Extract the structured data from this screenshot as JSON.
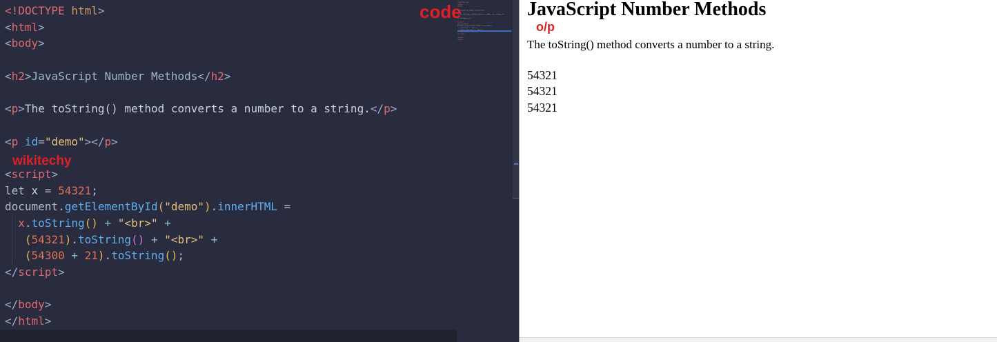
{
  "editor": {
    "watermark_top": "code",
    "watermark_overlay": "wikitechy",
    "lines": [
      {
        "tokens": [
          [
            "<!DOCTYPE",
            "red"
          ],
          [
            " html",
            "orange"
          ],
          [
            ">",
            "br"
          ]
        ]
      },
      {
        "tokens": [
          [
            "<",
            "br"
          ],
          [
            "html",
            "red"
          ],
          [
            ">",
            "br"
          ]
        ]
      },
      {
        "tokens": [
          [
            "<",
            "br"
          ],
          [
            "body",
            "red"
          ],
          [
            ">",
            "br"
          ]
        ]
      },
      {
        "tokens": []
      },
      {
        "tokens": [
          [
            "<",
            "br"
          ],
          [
            "h2",
            "red"
          ],
          [
            ">",
            "br"
          ],
          [
            "JavaScript Number Methods",
            "h2c"
          ],
          [
            "</",
            "br"
          ],
          [
            "h2",
            "red"
          ],
          [
            ">",
            "br"
          ]
        ]
      },
      {
        "tokens": []
      },
      {
        "tokens": [
          [
            "<",
            "br"
          ],
          [
            "p",
            "red"
          ],
          [
            ">",
            "br"
          ],
          [
            "The toString() method converts a number to a string.",
            "pc"
          ],
          [
            "</",
            "br"
          ],
          [
            "p",
            "red"
          ],
          [
            ">",
            "br"
          ]
        ]
      },
      {
        "tokens": []
      },
      {
        "tokens": [
          [
            "<",
            "br"
          ],
          [
            "p",
            "red"
          ],
          [
            " ",
            "fg"
          ],
          [
            "id",
            "blue"
          ],
          [
            "=",
            "fg"
          ],
          [
            "\"demo\"",
            "str"
          ],
          [
            "></",
            "br"
          ],
          [
            "p",
            "red"
          ],
          [
            ">",
            "br"
          ]
        ]
      },
      {
        "tokens": []
      },
      {
        "tokens": [
          [
            "<",
            "br"
          ],
          [
            "script",
            "red"
          ],
          [
            ">",
            "br"
          ]
        ]
      },
      {
        "tokens": [
          [
            "let ",
            "fg"
          ],
          [
            "x",
            "var"
          ],
          [
            " = ",
            "fg"
          ],
          [
            "54321",
            "num"
          ],
          [
            ";",
            "fg"
          ]
        ]
      },
      {
        "tokens": [
          [
            "document",
            "fg"
          ],
          [
            ".",
            "fg"
          ],
          [
            "getElementById",
            "blue"
          ],
          [
            "(",
            "par"
          ],
          [
            "\"demo\"",
            "str"
          ],
          [
            ")",
            "par"
          ],
          [
            ".",
            "fg"
          ],
          [
            "innerHTML",
            "blue"
          ],
          [
            " =",
            "fg"
          ]
        ]
      },
      {
        "tokens": [
          [
            "  ",
            "fg"
          ],
          [
            "x",
            "red"
          ],
          [
            ".",
            "fg"
          ],
          [
            "toString",
            "blue"
          ],
          [
            "()",
            "par"
          ],
          [
            " ",
            "fg"
          ],
          [
            "+",
            "op"
          ],
          [
            " ",
            "fg"
          ],
          [
            "\"<br>\"",
            "str"
          ],
          [
            " ",
            "fg"
          ],
          [
            "+",
            "op"
          ]
        ],
        "guide": true
      },
      {
        "tokens": [
          [
            "   ",
            "fg"
          ],
          [
            "(",
            "par"
          ],
          [
            "54321",
            "num"
          ],
          [
            ")",
            "par"
          ],
          [
            ".",
            "fg"
          ],
          [
            "toString",
            "blue"
          ],
          [
            "()",
            "orc"
          ],
          [
            " ",
            "fg"
          ],
          [
            "+",
            "op"
          ],
          [
            " ",
            "fg"
          ],
          [
            "\"<br>\"",
            "str"
          ],
          [
            " ",
            "fg"
          ],
          [
            "+",
            "op"
          ]
        ],
        "guide": true
      },
      {
        "tokens": [
          [
            "   ",
            "fg"
          ],
          [
            "(",
            "par"
          ],
          [
            "54300",
            "num"
          ],
          [
            " ",
            "fg"
          ],
          [
            "+",
            "op"
          ],
          [
            " ",
            "fg"
          ],
          [
            "21",
            "num"
          ],
          [
            ")",
            "par"
          ],
          [
            ".",
            "fg"
          ],
          [
            "toString",
            "blue"
          ],
          [
            "()",
            "par"
          ],
          [
            ";",
            "fg"
          ]
        ],
        "guide": true
      },
      {
        "tokens": [
          [
            "</",
            "br"
          ],
          [
            "script",
            "red"
          ],
          [
            ">",
            "br"
          ]
        ]
      },
      {
        "tokens": []
      },
      {
        "tokens": [
          [
            "</",
            "br"
          ],
          [
            "body",
            "red"
          ],
          [
            ">",
            "br"
          ]
        ]
      },
      {
        "tokens": [
          [
            "</",
            "br"
          ],
          [
            "html",
            "red"
          ],
          [
            ">",
            "br"
          ]
        ]
      }
    ]
  },
  "preview": {
    "heading": "JavaScript Number Methods",
    "op_label": "o/p",
    "paragraph": "The toString() method converts a number to a string.",
    "output_lines": [
      "54321",
      "54321",
      "54321"
    ]
  },
  "colors": {
    "editor_bg": "#282c3e",
    "tag_red": "#e06c75",
    "string_gold": "#e5c07b",
    "function_blue": "#61afef",
    "number_orange": "#de7156",
    "paren_gold": "#e8b94d",
    "paren_orchid": "#d670d6",
    "watermark_red": "#e01f26",
    "minimap_highlight_blue": "#3f6cc0",
    "preview_bg": "#ffffff",
    "preview_text": "#000000"
  }
}
